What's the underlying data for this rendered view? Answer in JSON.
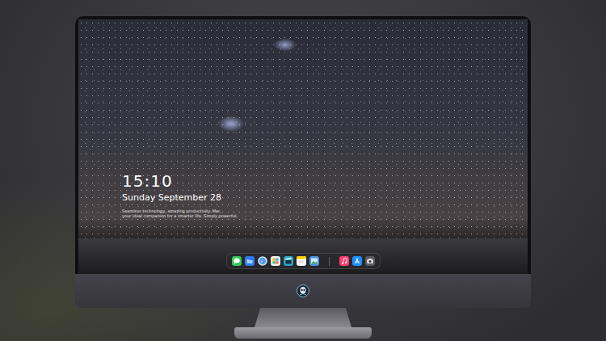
{
  "lock_screen": {
    "time": "15:10",
    "date": "Sunday September 28",
    "tagline": [
      "Seamless technology, amazing productivity. Mac,",
      "your ideal companion for a smarter life. Simply powerful."
    ]
  },
  "dock": {
    "items": [
      {
        "kind": "messages"
      },
      {
        "kind": "files"
      },
      {
        "kind": "safari"
      },
      {
        "kind": "photos"
      },
      {
        "kind": "clips"
      },
      {
        "kind": "notes"
      },
      {
        "kind": "preview"
      },
      {
        "kind": "separator"
      },
      {
        "kind": "music"
      },
      {
        "kind": "appstore"
      },
      {
        "kind": "camera"
      }
    ]
  }
}
